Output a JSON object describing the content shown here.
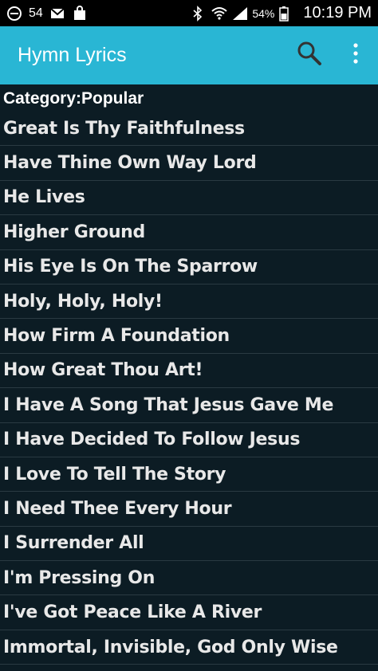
{
  "status_bar": {
    "notification_count": "54",
    "battery_percent": "54%",
    "time": "10:19 PM",
    "icons": [
      "do-not-disturb-icon",
      "gmail-icon",
      "store-icon",
      "bluetooth-icon",
      "wifi-icon",
      "signal-icon",
      "battery-icon"
    ]
  },
  "app_bar": {
    "title": "Hymn Lyrics",
    "color": "#29b6d4",
    "icons": [
      "search-icon",
      "overflow-menu-icon"
    ]
  },
  "category_label": "Category:Popular",
  "hymns": [
    "Great Is Thy Faithfulness",
    "Have Thine Own Way Lord",
    "He Lives",
    "Higher Ground",
    "His Eye Is On The Sparrow",
    "Holy, Holy, Holy!",
    "How Firm A Foundation",
    "How Great Thou Art!",
    "I Have A Song That Jesus Gave Me",
    "I Have Decided To Follow Jesus",
    "I Love To Tell The Story",
    "I Need Thee Every Hour",
    "I Surrender All",
    "I'm Pressing On",
    "I've Got Peace Like A River",
    "Immortal, Invisible, God Only Wise"
  ]
}
